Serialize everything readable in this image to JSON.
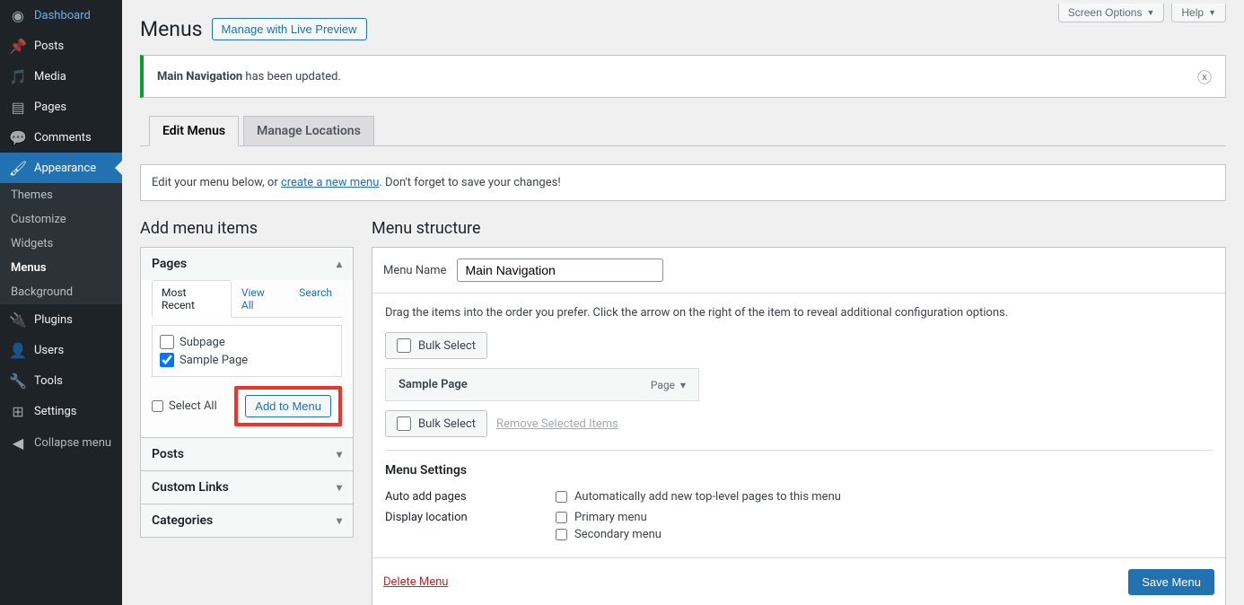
{
  "sidebar": {
    "items": [
      {
        "icon": "◉",
        "label": "Dashboard"
      },
      {
        "icon": "📌",
        "label": "Posts"
      },
      {
        "icon": "🎵",
        "label": "Media"
      },
      {
        "icon": "▤",
        "label": "Pages"
      },
      {
        "icon": "💬",
        "label": "Comments"
      },
      {
        "icon": "🖌",
        "label": "Appearance",
        "current": true
      },
      {
        "icon": "🔌",
        "label": "Plugins"
      },
      {
        "icon": "👤",
        "label": "Users"
      },
      {
        "icon": "🔧",
        "label": "Tools"
      },
      {
        "icon": "⊞",
        "label": "Settings"
      }
    ],
    "submenu": [
      "Themes",
      "Customize",
      "Widgets",
      "Menus",
      "Background"
    ],
    "submenu_current": "Menus",
    "collapse": "Collapse menu"
  },
  "topbar": {
    "screen_options": "Screen Options",
    "help": "Help"
  },
  "page_title": "Menus",
  "manage_preview_btn": "Manage with Live Preview",
  "notice": {
    "strong": "Main Navigation",
    "rest": " has been updated."
  },
  "tabs": {
    "edit": "Edit Menus",
    "locations": "Manage Locations"
  },
  "info_bar": {
    "pre": "Edit your menu below, or ",
    "link": "create a new menu",
    "post": ". Don't forget to save your changes!"
  },
  "left": {
    "heading": "Add menu items",
    "sections": [
      {
        "title": "Pages",
        "open": true
      },
      {
        "title": "Posts",
        "open": false
      },
      {
        "title": "Custom Links",
        "open": false
      },
      {
        "title": "Categories",
        "open": false
      }
    ],
    "pages": {
      "subtabs": [
        "Most Recent",
        "View All",
        "Search"
      ],
      "subtab_active": "Most Recent",
      "items": [
        {
          "label": "Subpage",
          "checked": false
        },
        {
          "label": "Sample Page",
          "checked": true
        }
      ],
      "select_all": "Select All",
      "add_btn": "Add to Menu"
    }
  },
  "right": {
    "heading": "Menu structure",
    "menu_name_label": "Menu Name",
    "menu_name_value": "Main Navigation",
    "desc": "Drag the items into the order you prefer. Click the arrow on the right of the item to reveal additional configuration options.",
    "bulk_select": "Bulk Select",
    "remove_selected": "Remove Selected Items",
    "menu_items": [
      {
        "title": "Sample Page",
        "type": "Page"
      }
    ],
    "settings": {
      "heading": "Menu Settings",
      "auto_add_label": "Auto add pages",
      "auto_add_check": "Automatically add new top-level pages to this menu",
      "display_label": "Display location",
      "locations": [
        "Primary menu",
        "Secondary menu"
      ]
    },
    "delete": "Delete Menu",
    "save": "Save Menu"
  }
}
